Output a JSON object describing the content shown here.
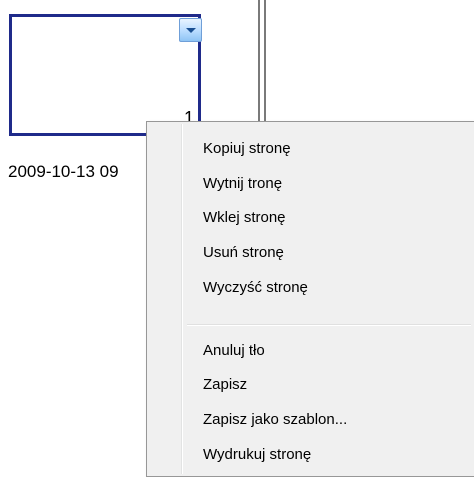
{
  "thumbnail": {
    "page_number": "1",
    "timestamp": "2009-10-13 09"
  },
  "context_menu": {
    "group1": [
      {
        "label": "Kopiuj stronę"
      },
      {
        "label": "Wytnij tronę"
      },
      {
        "label": "Wklej stronę"
      },
      {
        "label": "Usuń stronę"
      },
      {
        "label": "Wyczyść stronę"
      }
    ],
    "group2": [
      {
        "label": "Anuluj tło"
      },
      {
        "label": "Zapisz"
      },
      {
        "label": "Zapisz jako szablon..."
      },
      {
        "label": "Wydrukuj stronę"
      }
    ]
  },
  "colors": {
    "thumbnail_border": "#1f2a8a",
    "menu_background": "#f0f0f0",
    "dropdown_accent": "#8fc4f4"
  },
  "icons": {
    "dropdown": "chevron-down-icon"
  }
}
